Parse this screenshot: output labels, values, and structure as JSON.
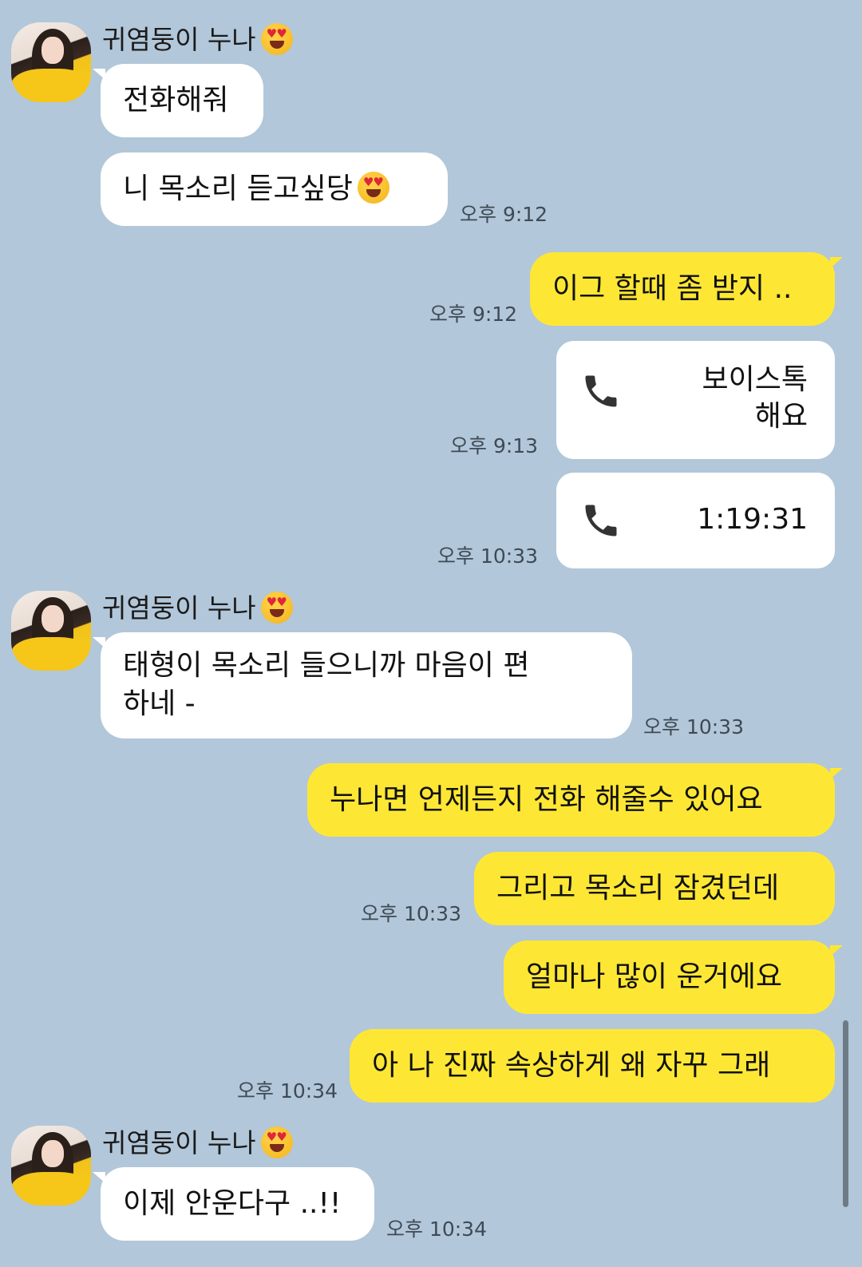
{
  "sender_name": "귀염둥이 누나",
  "sender_emoji": "smiling-face-with-heart-eyes-icon",
  "colors": {
    "background": "#b2c7d9",
    "my_bubble": "#fee734",
    "their_bubble": "#ffffff"
  },
  "messages": [
    {
      "from": "them",
      "text": "전화해줘"
    },
    {
      "from": "them",
      "text": "니 목소리 듣고싶당",
      "time": "오후 9:12"
    },
    {
      "from": "me",
      "text": "이그 할때 좀 받지 ..",
      "time": "오후 9:12"
    },
    {
      "from": "me",
      "type": "call",
      "text": "보이스톡 해요",
      "time": "오후 9:13"
    },
    {
      "from": "me",
      "type": "call",
      "text": "1:19:31",
      "time": "오후 10:33"
    },
    {
      "from": "them",
      "text": "태형이 목소리 들으니까 마음이 편하네 -",
      "time": "오후 10:33"
    },
    {
      "from": "me",
      "text": "누나면 언제든지 전화 해줄수 있어요"
    },
    {
      "from": "me",
      "text": "그리고 목소리 잠겼던데",
      "time": "오후 10:33"
    },
    {
      "from": "me",
      "text": "얼마나 많이 운거에요"
    },
    {
      "from": "me",
      "text": "아 나 진짜 속상하게 왜 자꾸 그래",
      "time": "오후 10:34"
    },
    {
      "from": "them",
      "text": "이제 안운다구 ..!!",
      "time": "오후 10:34"
    }
  ]
}
